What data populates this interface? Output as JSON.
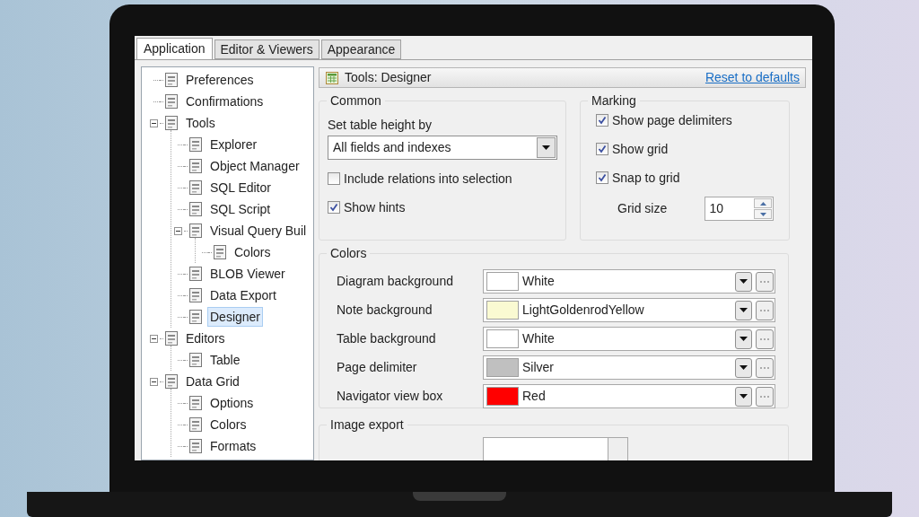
{
  "tabs": [
    {
      "label": "Application",
      "selected": true
    },
    {
      "label": "Editor & Viewers",
      "selected": false
    },
    {
      "label": "Appearance",
      "selected": false
    }
  ],
  "tree": [
    {
      "label": "Preferences",
      "selected": false
    },
    {
      "label": "Confirmations",
      "selected": false
    },
    {
      "label": "Tools",
      "selected": false,
      "expanded": true,
      "children": [
        {
          "label": "Explorer",
          "selected": false
        },
        {
          "label": "Object Manager",
          "selected": false
        },
        {
          "label": "SQL Editor",
          "selected": false
        },
        {
          "label": "SQL Script",
          "selected": false
        },
        {
          "label": "Visual Query Buil",
          "selected": false,
          "expanded": true,
          "children": [
            {
              "label": "Colors",
              "selected": false
            }
          ]
        },
        {
          "label": "BLOB Viewer",
          "selected": false
        },
        {
          "label": "Data Export",
          "selected": false
        },
        {
          "label": "Designer",
          "selected": true
        }
      ]
    },
    {
      "label": "Editors",
      "selected": false,
      "expanded": true,
      "children": [
        {
          "label": "Table",
          "selected": false
        }
      ]
    },
    {
      "label": "Data Grid",
      "selected": false,
      "expanded": true,
      "children": [
        {
          "label": "Options",
          "selected": false
        },
        {
          "label": "Colors",
          "selected": false
        },
        {
          "label": "Formats",
          "selected": false
        }
      ]
    }
  ],
  "panel": {
    "title": "Tools: Designer",
    "reset_link": "Reset to defaults",
    "common": {
      "title": "Common",
      "height_label": "Set table height by",
      "height_value": "All fields and indexes",
      "options": [
        {
          "label": "Include relations into selection",
          "checked": false
        },
        {
          "label": "Show hints",
          "checked": true
        }
      ]
    },
    "marking": {
      "title": "Marking",
      "options": [
        {
          "label": "Show page delimiters",
          "checked": true
        },
        {
          "label": "Show grid",
          "checked": true
        },
        {
          "label": "Snap to grid",
          "checked": true
        }
      ],
      "grid_size_label": "Grid size",
      "grid_size": "10"
    },
    "colors": {
      "title": "Colors",
      "rows": [
        {
          "label": "Diagram background",
          "value": "White",
          "color": "#ffffff"
        },
        {
          "label": "Note background",
          "value": "LightGoldenrodYellow",
          "color": "#fafad2"
        },
        {
          "label": "Table background",
          "value": "White",
          "color": "#ffffff"
        },
        {
          "label": "Page delimiter",
          "value": "Silver",
          "color": "#c0c0c0"
        },
        {
          "label": "Navigator view box",
          "value": "Red",
          "color": "#ff0000"
        }
      ]
    },
    "image_export": {
      "title": "Image export"
    }
  }
}
